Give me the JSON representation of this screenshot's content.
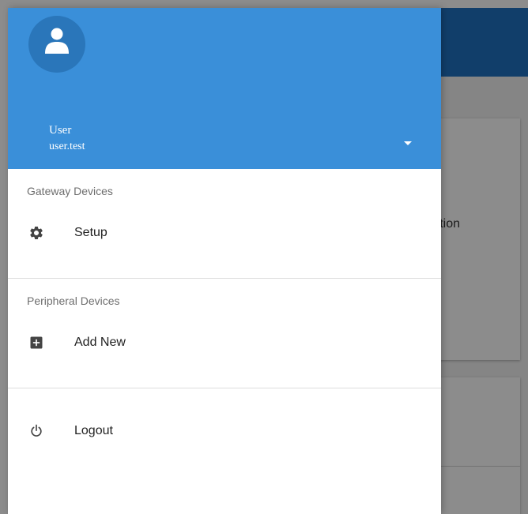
{
  "background_app": {
    "partial_text": "ration"
  },
  "drawer": {
    "account": {
      "name": "User",
      "username": "user.test"
    },
    "sections": [
      {
        "header": "Gateway Devices",
        "items": [
          {
            "label": "Setup",
            "icon": "gear-icon"
          }
        ]
      },
      {
        "header": "Peripheral Devices",
        "items": [
          {
            "label": "Add New",
            "icon": "add-box-icon"
          }
        ]
      }
    ],
    "logout": {
      "label": "Logout",
      "icon": "power-icon"
    }
  },
  "colors": {
    "drawer_header": "#3a8fd9",
    "avatar_bg": "#2a76ba",
    "toolbar_behind": "#1f72c2"
  }
}
